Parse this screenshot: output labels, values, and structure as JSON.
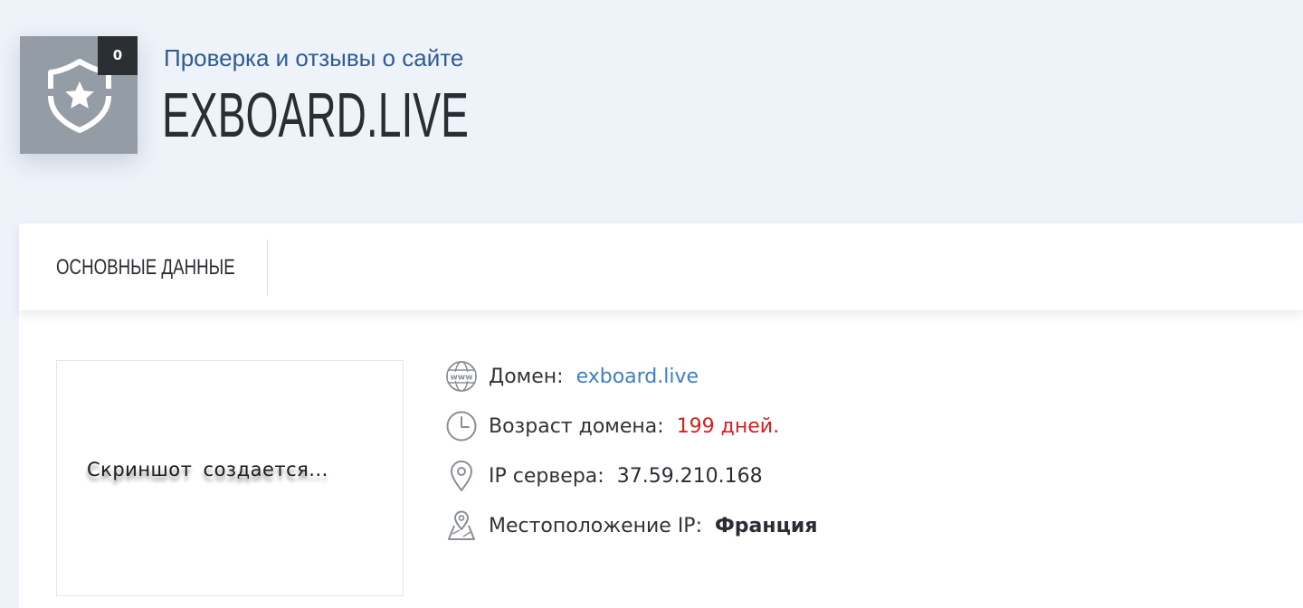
{
  "header": {
    "badge": {
      "icon": "shield-star-icon",
      "count": "0"
    },
    "subtitle": "Проверка и отзывы о сайте",
    "title": "EXBOARD.LIVE"
  },
  "tabs": [
    {
      "label": "ОСНОВНЫЕ ДАННЫЕ"
    }
  ],
  "screenshot": {
    "placeholder_text": "Скриншот  создается..."
  },
  "info": {
    "domain": {
      "icon": "www-globe-icon",
      "label": "Домен:",
      "value": "exboard.live"
    },
    "age": {
      "icon": "clock-icon",
      "label": "Возраст домена:",
      "value": "199 дней."
    },
    "ip": {
      "icon": "location-pin-icon",
      "label": "IP сервера:",
      "value": "37.59.210.168"
    },
    "location": {
      "icon": "map-pin-icon",
      "label": "Местоположение IP:",
      "value": "Франция"
    }
  },
  "colors": {
    "page_background": "#eef2f9",
    "accent_blue": "#2e5c94",
    "link_blue": "#3f7ec2",
    "age_red": "#d61f1f",
    "badge_gray": "#949ca5"
  }
}
